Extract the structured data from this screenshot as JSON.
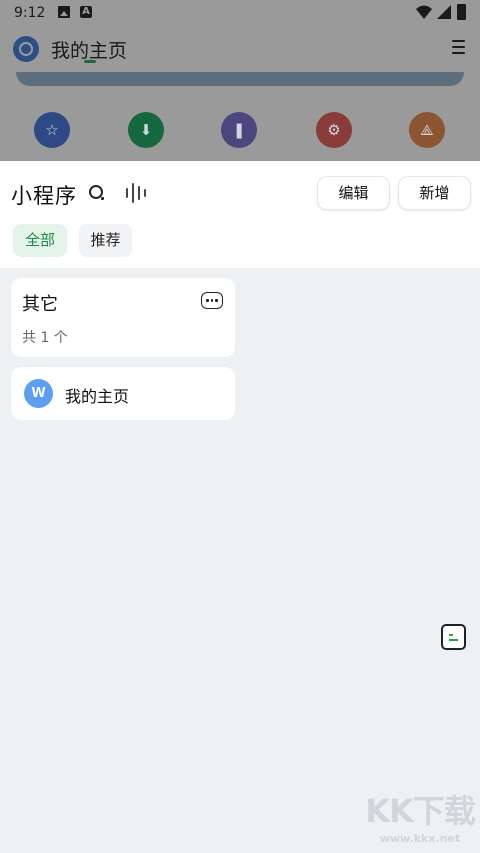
{
  "status_bar": {
    "time": "9:12",
    "icons": [
      "gallery-icon",
      "a-icon",
      "wifi-icon",
      "signal-icon",
      "battery-icon"
    ]
  },
  "background_app": {
    "title": "我的主页",
    "shortcut_icons": [
      "star-icon",
      "download-icon",
      "footprint-icon",
      "settings-icon",
      "share-icon"
    ]
  },
  "sheet": {
    "title": "小程序",
    "buttons": {
      "edit": "编辑",
      "add": "新增"
    },
    "tabs": [
      {
        "label": "全部",
        "active": true
      },
      {
        "label": "推荐",
        "active": false
      }
    ],
    "group": {
      "name": "其它",
      "count": "共 1 个"
    },
    "items": [
      {
        "name": "我的主页",
        "logo_letter": "W"
      }
    ]
  },
  "watermark": {
    "logo": "KK下载",
    "url": "www.kkx.net"
  },
  "colors": {
    "accent": "#1a8a43",
    "active_tab_bg": "#e5f4ea",
    "sheet_bg": "#eef1f4",
    "app_logo": "#5c9ef2"
  }
}
